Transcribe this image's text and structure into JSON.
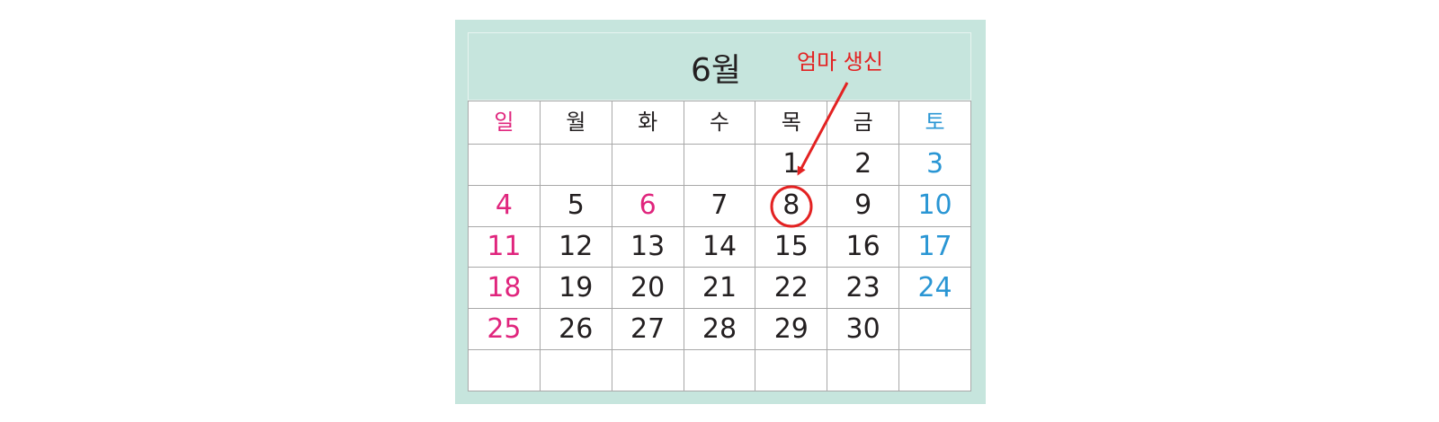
{
  "calendar": {
    "month_title": "6월",
    "weekdays": [
      {
        "label": "일",
        "kind": "sun"
      },
      {
        "label": "월",
        "kind": "day"
      },
      {
        "label": "화",
        "kind": "day"
      },
      {
        "label": "수",
        "kind": "day"
      },
      {
        "label": "목",
        "kind": "day"
      },
      {
        "label": "금",
        "kind": "day"
      },
      {
        "label": "토",
        "kind": "sat"
      }
    ],
    "weeks": [
      [
        "",
        "",
        "",
        "",
        "1",
        "2",
        "3"
      ],
      [
        "4",
        "5",
        "6",
        "7",
        "8",
        "9",
        "10"
      ],
      [
        "11",
        "12",
        "13",
        "14",
        "15",
        "16",
        "17"
      ],
      [
        "18",
        "19",
        "20",
        "21",
        "22",
        "23",
        "24"
      ],
      [
        "25",
        "26",
        "27",
        "28",
        "29",
        "30",
        ""
      ],
      [
        "",
        "",
        "",
        "",
        "",
        "",
        ""
      ]
    ],
    "holidays": [
      "6"
    ],
    "highlighted_day": "8"
  },
  "annotation": {
    "label": "엄마 생신",
    "target_day": "8"
  },
  "colors": {
    "frame_background": "#c6e5dd",
    "sunday_holiday": "#e0257d",
    "saturday": "#2a96d4",
    "text": "#231f20",
    "annotation": "#e32222",
    "grid_line": "#a8a8a8"
  }
}
